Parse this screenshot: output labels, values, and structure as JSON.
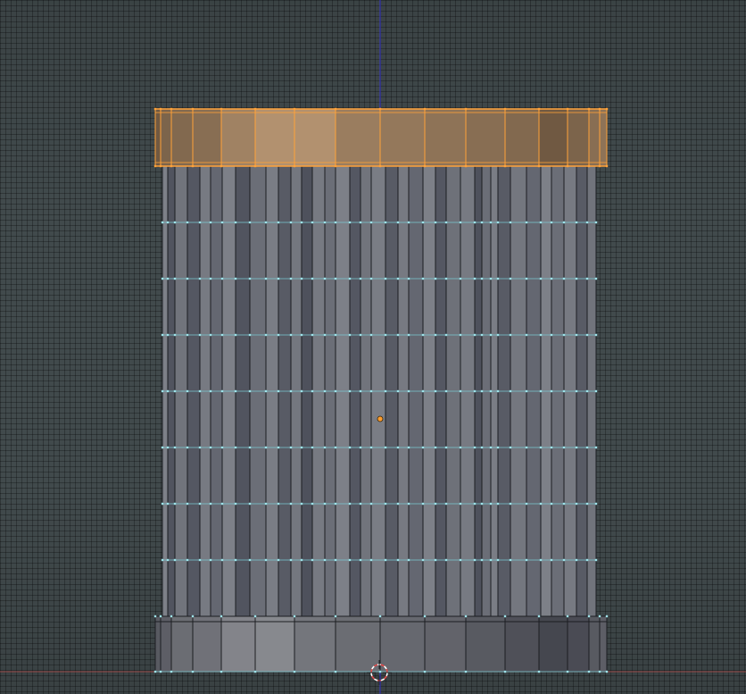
{
  "editor": {
    "name": "3D Viewport",
    "view": "front-orthographic",
    "mode": "edit-mode",
    "grid_visible": true
  },
  "mesh": {
    "type": "cylinder",
    "vertical_segments": 8,
    "selected_face_row": "top",
    "colors": {
      "unselected_face_light": "#8a8d94",
      "unselected_face_dark": "#4b4e59",
      "unselected_vertex": "#9fe3ea",
      "selected_edge": "#ffa23a",
      "selected_face_tint": "#b48a5a",
      "object_origin": "#ff9d2e",
      "z_axis": "#3a3acb",
      "x_axis": "#b04848",
      "cursor_red": "#e04a4a",
      "cursor_white": "#ffffff"
    }
  },
  "icons": {
    "cursor": "3d-cursor-icon",
    "origin": "object-origin-icon"
  }
}
